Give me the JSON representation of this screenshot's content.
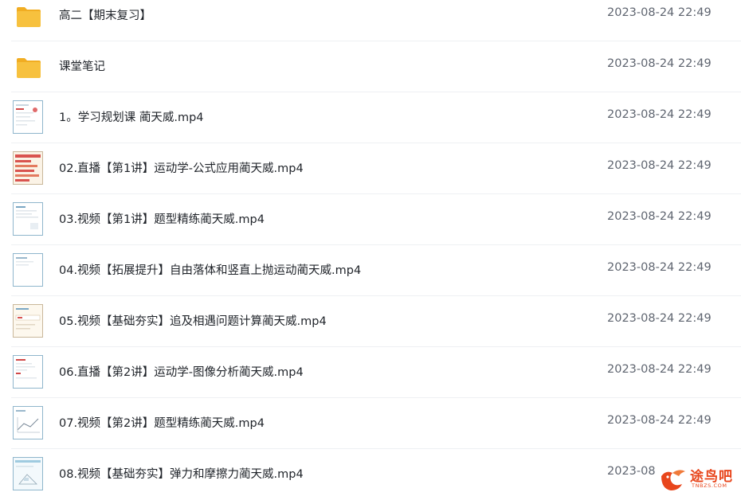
{
  "files": [
    {
      "icon": "folder-icon",
      "name": "高二【期末复习】",
      "modified": "2023-08-24 22:49"
    },
    {
      "icon": "folder-icon",
      "name": "课堂笔记",
      "modified": "2023-08-24 22:49"
    },
    {
      "icon": "video-thumbnail-icon",
      "name": "1。学习规划课 蔺天威.mp4",
      "modified": "2023-08-24 22:49"
    },
    {
      "icon": "video-thumbnail-icon",
      "name": "02.直播【第1讲】运动学-公式应用蔺天威.mp4",
      "modified": "2023-08-24 22:49"
    },
    {
      "icon": "video-thumbnail-icon",
      "name": "03.视频【第1讲】题型精练蔺天威.mp4",
      "modified": "2023-08-24 22:49"
    },
    {
      "icon": "video-thumbnail-icon",
      "name": "04.视频【拓展提升】自由落体和竖直上抛运动蔺天威.mp4",
      "modified": "2023-08-24 22:49"
    },
    {
      "icon": "video-thumbnail-icon",
      "name": "05.视频【基础夯实】追及相遇问题计算蔺天威.mp4",
      "modified": "2023-08-24 22:49"
    },
    {
      "icon": "video-thumbnail-icon",
      "name": "06.直播【第2讲】运动学-图像分析蔺天威.mp4",
      "modified": "2023-08-24 22:49"
    },
    {
      "icon": "video-thumbnail-icon",
      "name": "07.视频【第2讲】题型精练蔺天威.mp4",
      "modified": "2023-08-24 22:49"
    },
    {
      "icon": "video-thumbnail-icon",
      "name": "08.视频【基础夯实】弹力和摩擦力蔺天威.mp4",
      "modified": "2023-08"
    }
  ],
  "watermark": {
    "text": "途鸟吧",
    "sub": "TNBZS.COM"
  },
  "colors": {
    "folder": "#f7c13e",
    "folder_tab": "#f1ad22",
    "text": "#1f2329",
    "time": "#5f6570",
    "watermark": "#e8461c"
  }
}
